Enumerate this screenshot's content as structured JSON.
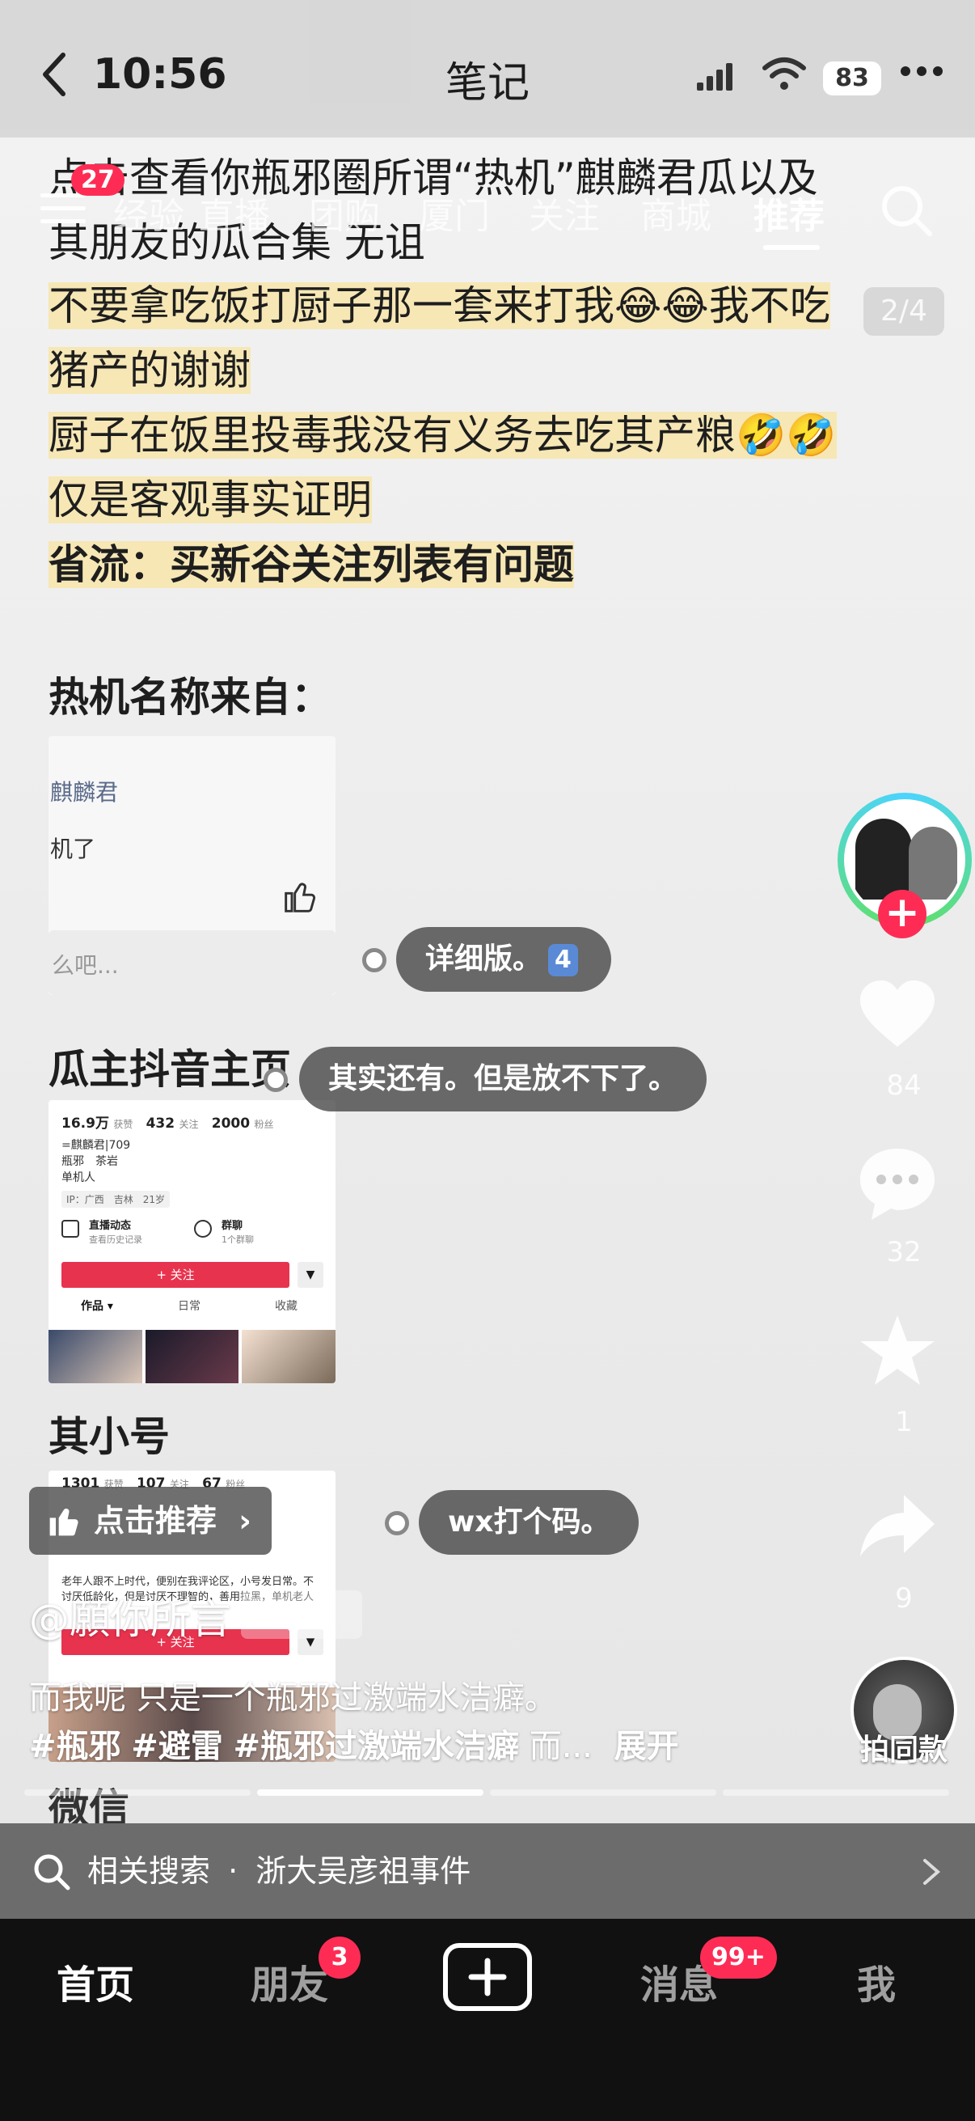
{
  "status_bar": {
    "time": "10:56",
    "title": "笔记",
    "battery": "83"
  },
  "top_tabs": {
    "badge": "27",
    "items": [
      "经验",
      "直播",
      "团购",
      "厦门",
      "关注",
      "商城",
      "推荐"
    ],
    "active": "推荐"
  },
  "page_counter": "2/4",
  "note": {
    "title_line1": "点击查看你瓶邪圈所谓“热机”麒麟君瓜以及",
    "title_line2": "其朋友的瓜合集 无诅",
    "line1": "不要拿吃饭打厨子那一套来打我😂😂我不吃",
    "line2": "猪产的谢谢",
    "line3": "厨子在饭里投毒我没有义务去吃其产粮🤣🤣",
    "line4": "仅是客观事实证明",
    "line5": "省流：买新谷关注列表有问题",
    "heading1": "热机名称来自：",
    "shot1_name": "麒麟君",
    "shot1_text": "机了",
    "shot1_input": "么吧...",
    "heading2": "瓜主抖音主页",
    "shot2": {
      "likes": "16.9万",
      "likes_label": "获赞",
      "following": "432",
      "following_label": "关注",
      "fans": "2000",
      "fans_label": "粉丝",
      "handle": "=麒麟君|709",
      "tags": "瓶邪　茶岩",
      "bio": "单机人",
      "ip": "IP：广西　吉林　21岁",
      "live": "直播动态",
      "live_sub": "查看历史记录",
      "group": "群聊",
      "group_sub": "1个群聊",
      "follow_btn": "+ 关注",
      "tab1": "作品 ▾",
      "tab2": "日常",
      "tab3": "收藏"
    },
    "heading3": "其小号",
    "shot3": {
      "likes": "1301",
      "likes_label": "获赞",
      "following": "107",
      "following_label": "关注",
      "fans": "67",
      "fans_label": "粉丝",
      "bio": "老年人跟不上时代，便别在我评论区，小号发日常。不讨厌低龄化，但是讨厌不理智的，善用拉黑，单机老人",
      "follow_btn": "+ 关注"
    },
    "heading4": "微信"
  },
  "danmaku": [
    {
      "text": "详细版。",
      "num": "4"
    },
    {
      "text": "其实还有。但是放不下了。"
    },
    {
      "text": "wx打个码。"
    }
  ],
  "sidebar": {
    "likes": "84",
    "comments": "32",
    "favorites": "1",
    "shares": "9"
  },
  "recommend_label": "点击推荐",
  "author": "@願你所言",
  "description": "而我呢 只是一个瓶邪过激端水洁癖。",
  "tags": [
    "#瓶邪",
    "#避雷",
    "#瓶邪过激端水洁癖"
  ],
  "ellipsis": "而...",
  "expand_label": "展开",
  "same_style_label": "拍同款",
  "related_search": {
    "prefix": "相关搜索",
    "dot": "·",
    "query": "浙大吴彦祖事件"
  },
  "bottom_nav": {
    "home": "首页",
    "friends": "朋友",
    "friends_badge": "3",
    "messages": "消息",
    "messages_badge": "99+",
    "me": "我"
  }
}
